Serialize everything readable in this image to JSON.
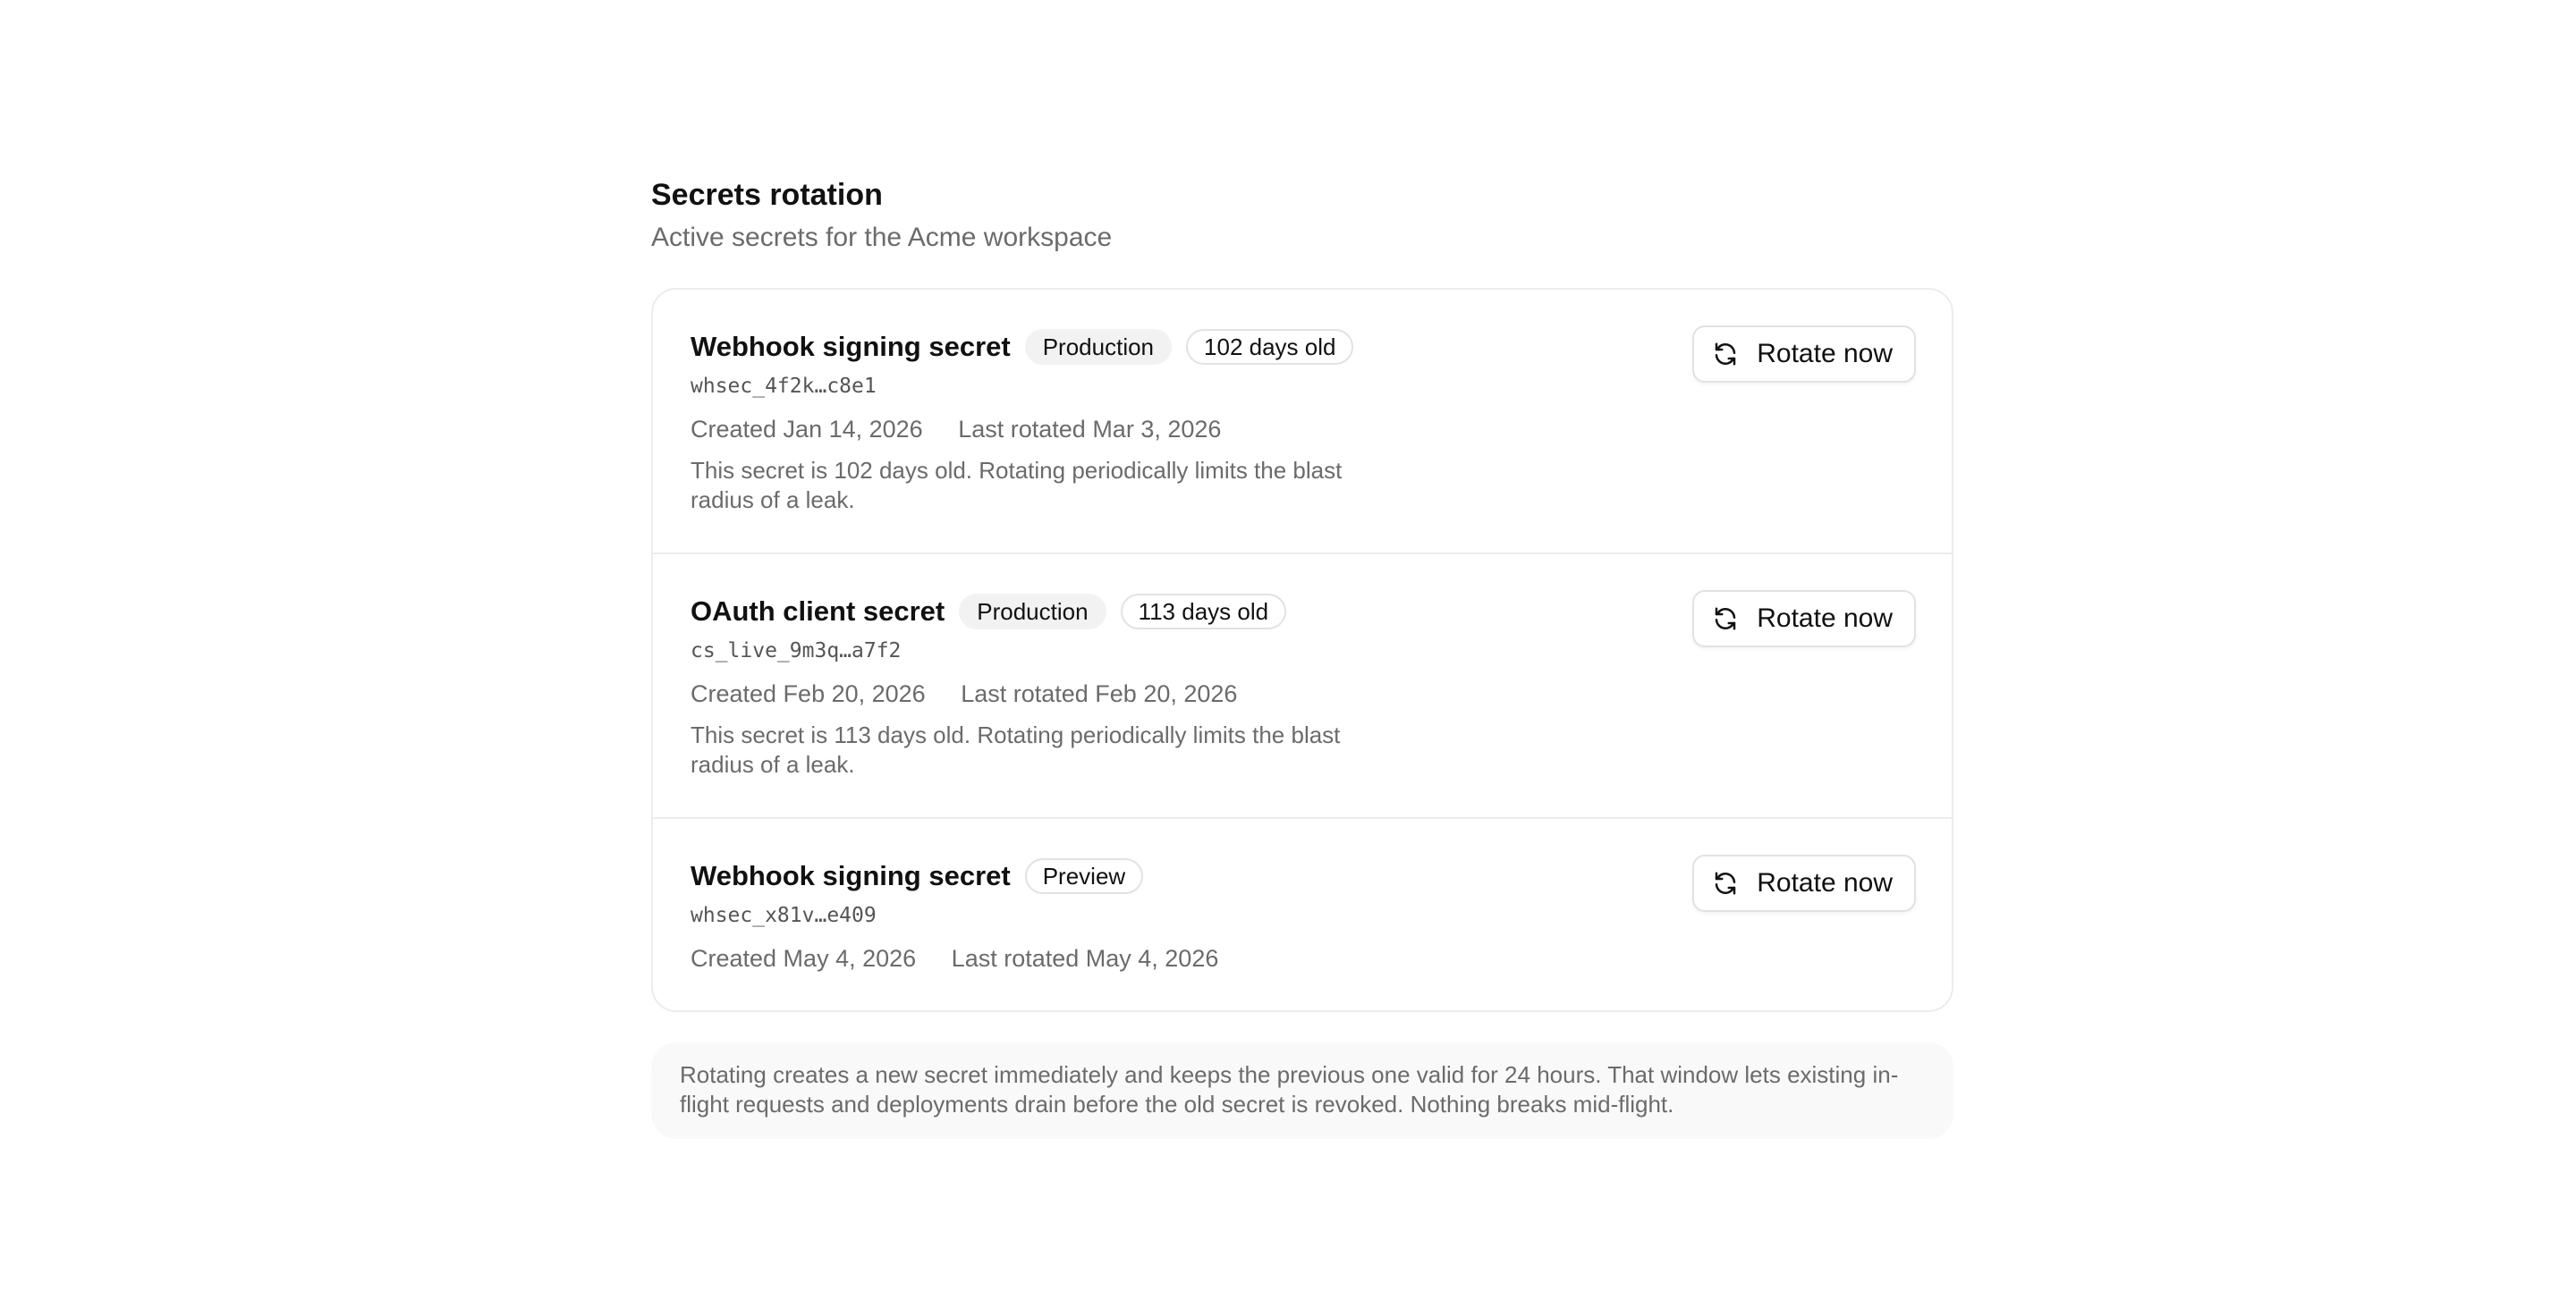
{
  "header": {
    "title": "Secrets rotation",
    "subtitle": "Active secrets for the Acme workspace"
  },
  "secrets": [
    {
      "name": "Webhook signing secret",
      "environment": "Production",
      "age_badge": "102 days old",
      "key": "whsec_4f2k…c8e1",
      "created": "Created Jan 14, 2026",
      "last_rotated": "Last rotated Mar 3, 2026",
      "note": "This secret is 102 days old. Rotating periodically limits the blast radius of a leak.",
      "action_label": "Rotate now"
    },
    {
      "name": "OAuth client secret",
      "environment": "Production",
      "age_badge": "113 days old",
      "key": "cs_live_9m3q…a7f2",
      "created": "Created Feb 20, 2026",
      "last_rotated": "Last rotated Feb 20, 2026",
      "note": "This secret is 113 days old. Rotating periodically limits the blast radius of a leak.",
      "action_label": "Rotate now"
    },
    {
      "name": "Webhook signing secret",
      "environment": "Preview",
      "key": "whsec_x81v…e409",
      "created": "Created May 4, 2026",
      "last_rotated": "Last rotated May 4, 2026",
      "action_label": "Rotate now"
    }
  ],
  "footer": {
    "note": "Rotating creates a new secret immediately and keeps the previous one valid for 24 hours. That window lets existing in-flight requests and deployments drain before the old secret is revoked. Nothing breaks mid-flight."
  },
  "icons": {
    "rotate": "refresh-icon"
  }
}
